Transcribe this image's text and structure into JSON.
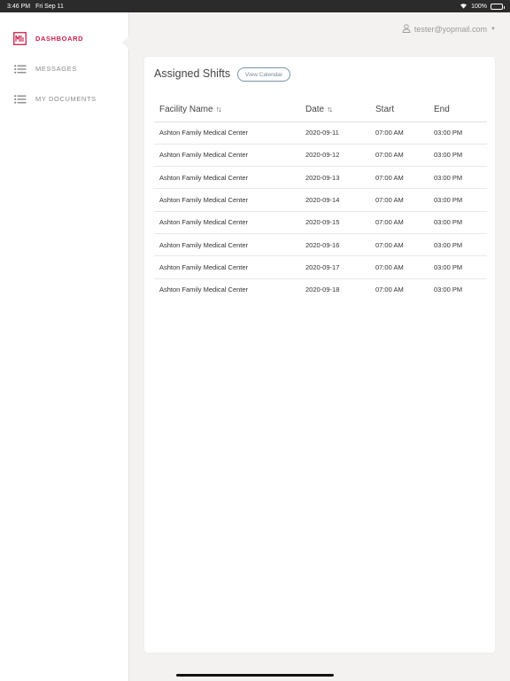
{
  "status": {
    "time": "3:46 PM",
    "date": "Fri Sep 11",
    "battery": "100%",
    "battery_level": 1.0
  },
  "sidebar": {
    "items": [
      {
        "label": "DASHBOARD",
        "icon": "dashboard-logo-icon",
        "active": true
      },
      {
        "label": "MESSAGES",
        "icon": "list-icon",
        "active": false
      },
      {
        "label": "MY DOCUMENTS",
        "icon": "list-icon",
        "active": false
      }
    ]
  },
  "header": {
    "user_email": "tester@yopmail.com"
  },
  "colors": {
    "accent": "#c8204a",
    "muted": "#8a8a8a",
    "background": "#f4f2f1"
  },
  "main": {
    "title": "Assigned Shifts",
    "view_calendar": "View Calendar",
    "columns": [
      "Facility Name",
      "Date",
      "Start",
      "End"
    ],
    "rows": [
      [
        "Ashton Family Medical Center",
        "2020-09-11",
        "07:00 AM",
        "03:00 PM"
      ],
      [
        "Ashton Family Medical Center",
        "2020-09-12",
        "07:00 AM",
        "03:00 PM"
      ],
      [
        "Ashton Family Medical Center",
        "2020-09-13",
        "07:00 AM",
        "03:00 PM"
      ],
      [
        "Ashton Family Medical Center",
        "2020-09-14",
        "07:00 AM",
        "03:00 PM"
      ],
      [
        "Ashton Family Medical Center",
        "2020-09-15",
        "07:00 AM",
        "03:00 PM"
      ],
      [
        "Ashton Family Medical Center",
        "2020-09-16",
        "07:00 AM",
        "03:00 PM"
      ],
      [
        "Ashton Family Medical Center",
        "2020-09-17",
        "07:00 AM",
        "03:00 PM"
      ],
      [
        "Ashton Family Medical Center",
        "2020-09-18",
        "07:00 AM",
        "03:00 PM"
      ]
    ]
  }
}
